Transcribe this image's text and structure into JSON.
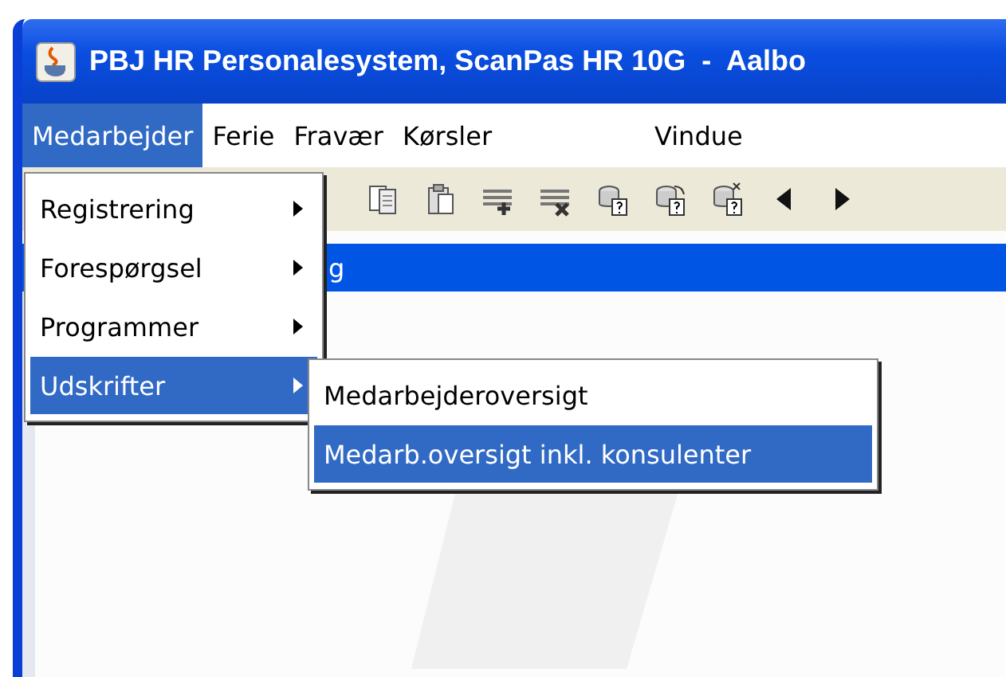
{
  "window": {
    "title": "PBJ HR Personalesystem, ScanPas HR 10G  -  Aalbo"
  },
  "menu_bar": [
    {
      "label": "Medarbejder",
      "selected": true
    },
    {
      "label": "Ferie",
      "selected": false
    },
    {
      "label": "Fravær",
      "selected": false
    },
    {
      "label": "Kørsler",
      "selected": false
    },
    {
      "label": "Vindue",
      "selected": false
    }
  ],
  "menu": {
    "items": [
      {
        "label": "Registrering",
        "selected": false,
        "has_submenu": true
      },
      {
        "label": "Forespørgsel",
        "selected": false,
        "has_submenu": true
      },
      {
        "label": "Programmer",
        "selected": false,
        "has_submenu": true
      },
      {
        "label": "Udskrifter",
        "selected": true,
        "has_submenu": true
      }
    ]
  },
  "submenu": {
    "items": [
      {
        "label": "Medarbejderoversigt",
        "selected": false
      },
      {
        "label": "Medarb.oversigt inkl. konsulenter",
        "selected": true
      }
    ]
  },
  "toolbar": [
    {
      "kind": "copy"
    },
    {
      "kind": "paste"
    },
    {
      "kind": "add-row"
    },
    {
      "kind": "delete-row"
    },
    {
      "kind": "query"
    },
    {
      "kind": "query-next"
    },
    {
      "kind": "query-clear"
    },
    {
      "kind": "prev"
    },
    {
      "kind": "next"
    }
  ],
  "selected_row": {
    "text": "g"
  }
}
